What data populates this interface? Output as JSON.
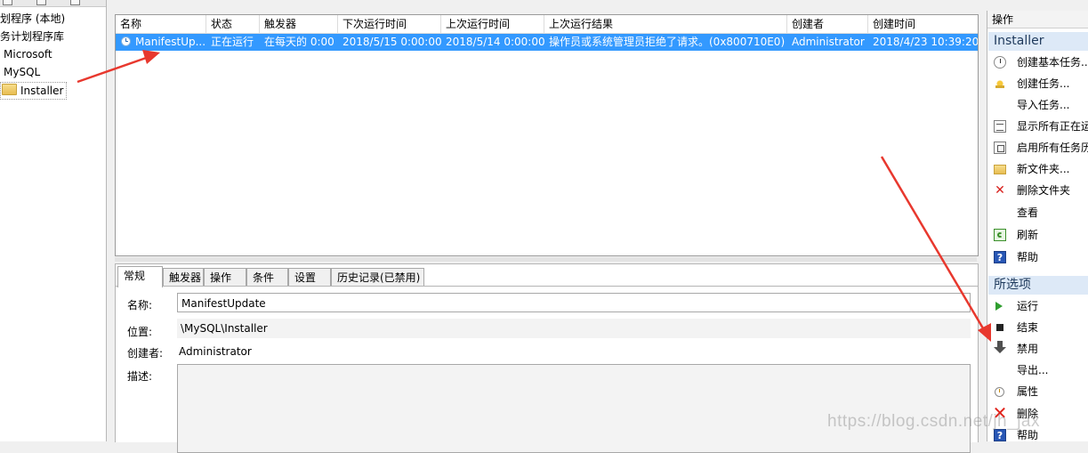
{
  "tree": {
    "items": [
      {
        "label": "划程序 (本地)"
      },
      {
        "label": "务计划程序库"
      },
      {
        "label": "Microsoft"
      },
      {
        "label": "MySQL"
      },
      {
        "label": "Installer",
        "icon": "folder-icon",
        "selected": true
      }
    ]
  },
  "task_list": {
    "columns": [
      "名称",
      "状态",
      "触发器",
      "下次运行时间",
      "上次运行时间",
      "上次运行结果",
      "创建者",
      "创建时间"
    ],
    "rows": [
      {
        "name": "ManifestUp...",
        "status": "正在运行",
        "trigger": "在每天的 0:00",
        "next_run": "2018/5/15 0:00:00",
        "last_run": "2018/5/14 0:00:00",
        "last_result": "操作员或系统管理员拒绝了请求。(0x800710E0)",
        "author": "Administrator",
        "created": "2018/4/23 10:39:20",
        "selected": true
      }
    ]
  },
  "detail": {
    "tabs": [
      "常规",
      "触发器",
      "操作",
      "条件",
      "设置",
      "历史记录(已禁用)"
    ],
    "active_tab": "常规",
    "name_label": "名称:",
    "name_value": "ManifestUpdate",
    "location_label": "位置:",
    "location_value": "\\MySQL\\Installer",
    "author_label": "创建者:",
    "author_value": "Administrator",
    "description_label": "描述:"
  },
  "actions_pane": {
    "title": "操作",
    "folder_section": {
      "title": "Installer",
      "items": [
        {
          "label": "创建基本任务...",
          "icon": "create-basic-task-icon"
        },
        {
          "label": "创建任务...",
          "icon": "create-task-icon"
        },
        {
          "label": "导入任务...",
          "icon": ""
        },
        {
          "label": "显示所有正在运",
          "icon": "running-tasks-icon"
        },
        {
          "label": "启用所有任务历",
          "icon": "task-history-icon"
        },
        {
          "label": "新文件夹...",
          "icon": "new-folder-icon"
        },
        {
          "label": "删除文件夹",
          "icon": "delete-folder-icon"
        },
        {
          "label": "查看",
          "icon": ""
        },
        {
          "label": "刷新",
          "icon": "refresh-icon"
        },
        {
          "label": "帮助",
          "icon": "help-icon"
        }
      ]
    },
    "selection_section": {
      "title": "所选项",
      "items": [
        {
          "label": "运行",
          "icon": "run-icon"
        },
        {
          "label": "结束",
          "icon": "stop-icon"
        },
        {
          "label": "禁用",
          "icon": "disable-icon"
        },
        {
          "label": "导出...",
          "icon": ""
        },
        {
          "label": "属性",
          "icon": "properties-icon"
        },
        {
          "label": "删除",
          "icon": "delete-icon"
        },
        {
          "label": "帮助",
          "icon": "help-icon"
        }
      ]
    }
  },
  "watermark": "https://blog.csdn.net/jh_jax",
  "colors": {
    "selection": "#3399ff",
    "section_header": "#dde9f7",
    "annotation_arrow": "#e8382e"
  }
}
